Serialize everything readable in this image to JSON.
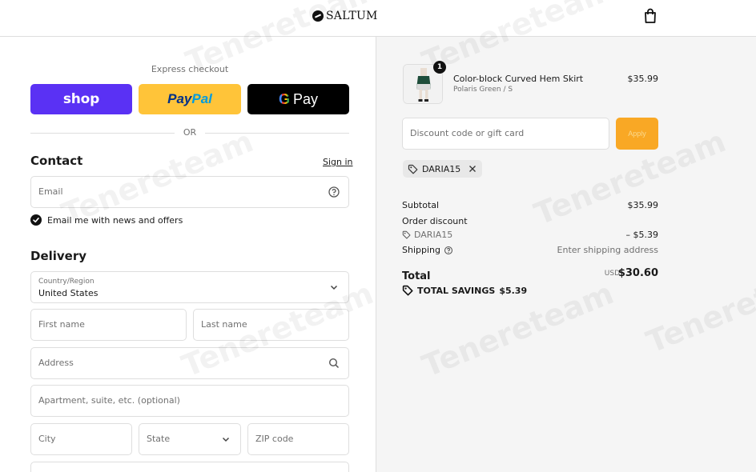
{
  "header": {
    "brand_name": "SALTUM",
    "cart_icon": "shopping-bag-icon"
  },
  "express": {
    "label": "Express checkout",
    "shop_label": "shop",
    "paypal_label_1": "Pay",
    "paypal_label_2": "Pal",
    "gpay_g": "G",
    "gpay_label": "Pay",
    "or_label": "OR"
  },
  "contact": {
    "title": "Contact",
    "sign_in": "Sign in",
    "email_placeholder": "Email",
    "newsletter_label": "Email me with news and offers",
    "newsletter_checked": true
  },
  "delivery": {
    "title": "Delivery",
    "country_label": "Country/Region",
    "country_value": "United States",
    "first_name_placeholder": "First name",
    "last_name_placeholder": "Last name",
    "address_placeholder": "Address",
    "apartment_placeholder": "Apartment, suite, etc. (optional)",
    "city_placeholder": "City",
    "state_placeholder": "State",
    "zip_placeholder": "ZIP code"
  },
  "order": {
    "item": {
      "quantity": "1",
      "name": "Color-block Curved Hem Skirt",
      "variant": "Polaris Green / S",
      "price": "$35.99"
    },
    "discount_placeholder": "Discount code or gift card",
    "apply_label": "Apply",
    "applied_code": "DARIA15",
    "subtotal_label": "Subtotal",
    "subtotal_value": "$35.99",
    "order_discount_label": "Order discount",
    "discount_code": "DARIA15",
    "discount_value": "– $5.39",
    "shipping_label": "Shipping",
    "shipping_value": "Enter shipping address",
    "total_label": "Total",
    "total_currency": "USD",
    "total_value": "$30.60",
    "savings_label": "TOTAL SAVINGS",
    "savings_value": "$5.39"
  },
  "watermark": "Tenereteam",
  "colors": {
    "shop_purple": "#5a31f4",
    "paypal_yellow": "#ffc439",
    "apply_orange": "#f9a825"
  }
}
